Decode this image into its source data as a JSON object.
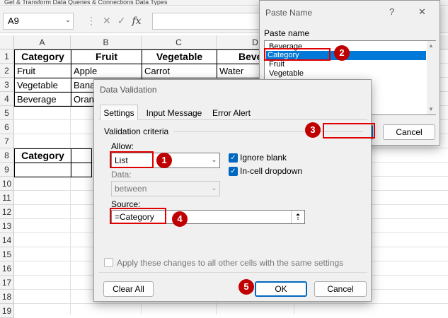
{
  "ribbon": {
    "text": "Get & Transform Data   Queries & Connections   Data Types"
  },
  "formula_bar": {
    "name_box": "A9",
    "fx": "fx"
  },
  "sheet": {
    "columns": [
      "A",
      "B",
      "C",
      "D"
    ],
    "rows": [
      "1",
      "2",
      "3",
      "4",
      "5",
      "6",
      "7",
      "8",
      "9",
      "10",
      "11",
      "12",
      "13",
      "14",
      "15",
      "16",
      "17",
      "18",
      "19"
    ],
    "cells": {
      "A1": "Category",
      "B1": "Fruit",
      "C1": "Vegetable",
      "D1": "Beve",
      "A2": "Fruit",
      "B2": "Apple",
      "C2": "Carrot",
      "D2": "Water",
      "A3": "Vegetable",
      "B3": "Bana",
      "A4": "Beverage",
      "B4": "Oran",
      "A8": "Category"
    }
  },
  "paste_name": {
    "title": "Paste Name",
    "help": "?",
    "close": "✕",
    "label": "Paste name",
    "items": [
      "Beverage",
      "Category",
      "Fruit",
      "Vegetable"
    ],
    "selected": "Category",
    "ok": "OK",
    "cancel": "Cancel"
  },
  "data_validation": {
    "title": "Data Validation",
    "tabs": [
      "Settings",
      "Input Message",
      "Error Alert"
    ],
    "active_tab": "Settings",
    "criteria_label": "Validation criteria",
    "allow_label": "Allow:",
    "allow_value": "List",
    "data_label": "Data:",
    "data_value": "between",
    "ignore_blank": "Ignore blank",
    "in_cell_dropdown": "In-cell dropdown",
    "source_label": "Source:",
    "source_value": "=Category",
    "apply_all": "Apply these changes to all other cells with the same settings",
    "clear_all": "Clear All",
    "ok": "OK",
    "cancel": "Cancel"
  },
  "badges": [
    "1",
    "2",
    "3",
    "4",
    "5"
  ]
}
